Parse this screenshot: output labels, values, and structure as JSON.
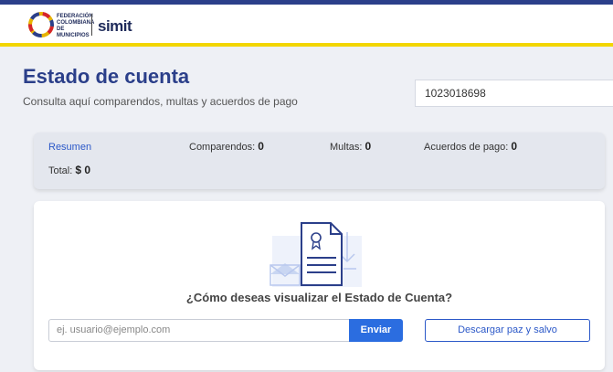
{
  "header": {
    "logo_text": "FEDERACIÓN COLOMBIANA DE MUNICIPIOS",
    "brand": "simit"
  },
  "page": {
    "title": "Estado de cuenta",
    "subtitle": "Consulta aquí comparendos, multas y acuerdos de pago"
  },
  "search": {
    "value": "1023018698"
  },
  "summary": {
    "tab_label": "Resumen",
    "comparendos_label": "Comparendos:",
    "comparendos_value": "0",
    "multas_label": "Multas:",
    "multas_value": "0",
    "acuerdos_label": "Acuerdos de pago:",
    "acuerdos_value": "0",
    "total_label": "Total:",
    "total_value": "$ 0"
  },
  "card": {
    "question": "¿Cómo deseas visualizar el Estado de Cuenta?",
    "email_placeholder": "ej. usuario@ejemplo.com",
    "send_label": "Enviar",
    "download_label": "Descargar paz y salvo"
  },
  "colors": {
    "primary": "#2b3f8a",
    "accent_yellow": "#f2d600",
    "button_blue": "#2b6de0"
  }
}
